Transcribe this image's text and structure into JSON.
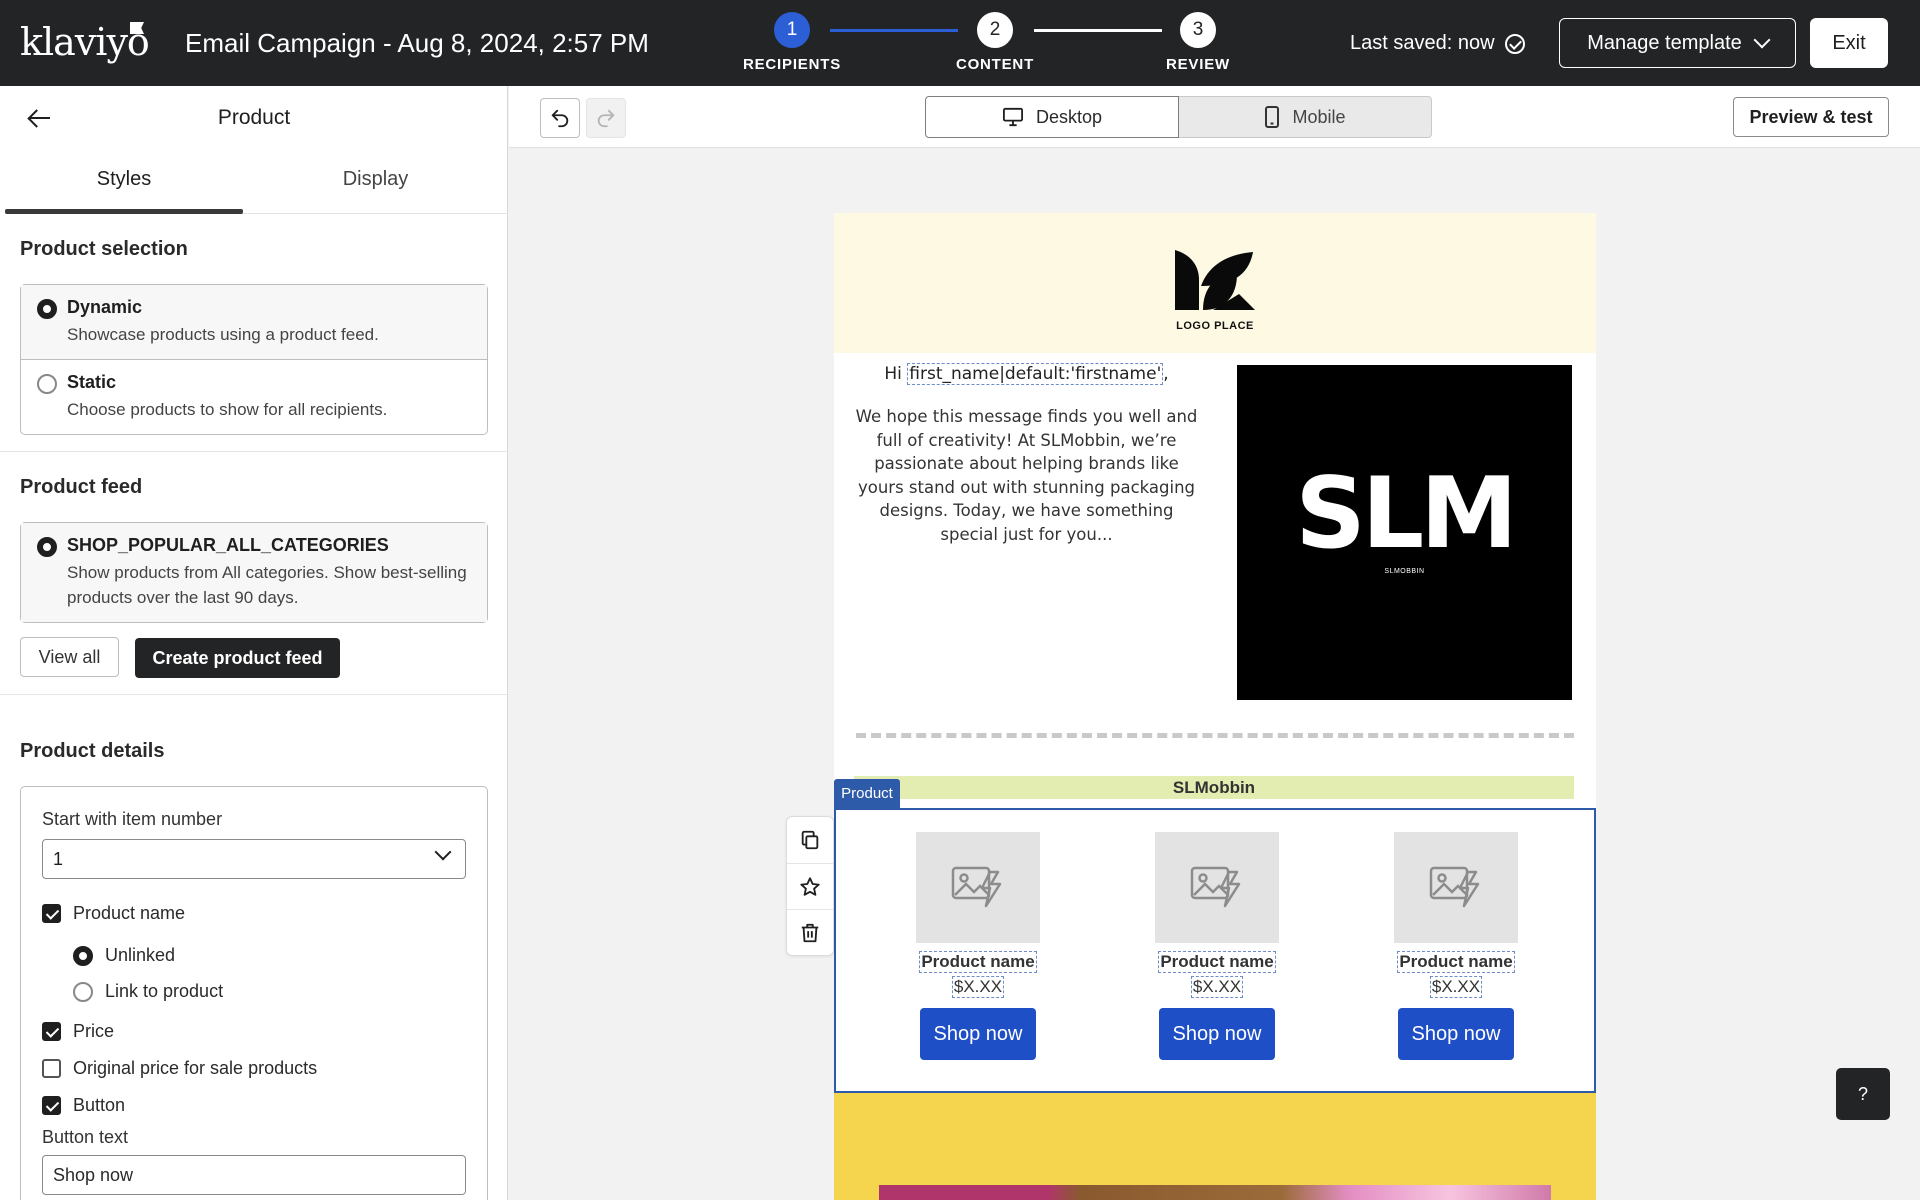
{
  "app": {
    "logo_text": "klaviyo"
  },
  "header": {
    "campaign_title": "Email Campaign - Aug 8, 2024, 2:57 PM",
    "steps": [
      {
        "number": "1",
        "label": "RECIPIENTS"
      },
      {
        "number": "2",
        "label": "CONTENT"
      },
      {
        "number": "3",
        "label": "REVIEW"
      }
    ],
    "last_saved": "Last saved: now",
    "manage_template": "Manage template",
    "exit": "Exit"
  },
  "panel": {
    "title": "Product",
    "tabs": [
      "Styles",
      "Display"
    ],
    "product_selection": {
      "title": "Product selection",
      "options": [
        {
          "label": "Dynamic",
          "desc": "Showcase products using a product feed."
        },
        {
          "label": "Static",
          "desc": "Choose products to show for all recipients."
        }
      ]
    },
    "product_feed": {
      "title": "Product feed",
      "feed_label": "SHOP_POPULAR_ALL_CATEGORIES",
      "feed_desc": "Show products from All categories. Show best-selling products over the last 90 days.",
      "view_all": "View all",
      "create_feed": "Create product feed"
    },
    "product_details": {
      "title": "Product details",
      "start_label": "Start with item number",
      "start_value": "1",
      "product_name": "Product name",
      "unlinked": "Unlinked",
      "link_to_product": "Link to product",
      "price": "Price",
      "original_price": "Original price for sale products",
      "button": "Button",
      "button_text_label": "Button text",
      "button_text_value": "Shop now"
    }
  },
  "toolbar": {
    "desktop": "Desktop",
    "mobile": "Mobile",
    "preview": "Preview & test"
  },
  "email": {
    "logo_place": "LOGO PLACE",
    "greeting_prefix": "Hi ",
    "greeting_tag": "first_name|default:'firstname'",
    "greeting_suffix": ",",
    "body": "We hope this message finds you well and full of creativity! At SLMobbin, we’re passionate about helping brands like yours stand out with stunning packaging designs. Today, we have something special just for you...",
    "hero_logo": "SLM",
    "hero_sub": "SLMOBBIN",
    "brand_bar": "SLMobbin",
    "product_chip": "Product",
    "products": [
      {
        "name": "Product name",
        "price": "$X.XX",
        "button": "Shop now"
      },
      {
        "name": "Product name",
        "price": "$X.XX",
        "button": "Shop now"
      },
      {
        "name": "Product name",
        "price": "$X.XX",
        "button": "Shop now"
      }
    ]
  },
  "help": "?",
  "colors": {
    "topbar": "#232426",
    "accent_blue": "#2c5ed6",
    "shop_button": "#1f4fc6",
    "header_cream": "#fdf9e3",
    "brand_bar": "#e3ecb1",
    "footer_yellow": "#f4d54d"
  },
  "icons": [
    "back-arrow-icon",
    "undo-icon",
    "redo-icon",
    "desktop-icon",
    "mobile-icon",
    "duplicate-icon",
    "star-icon",
    "trash-icon",
    "image-placeholder-icon",
    "check-circle-icon",
    "chevron-down-icon"
  ]
}
